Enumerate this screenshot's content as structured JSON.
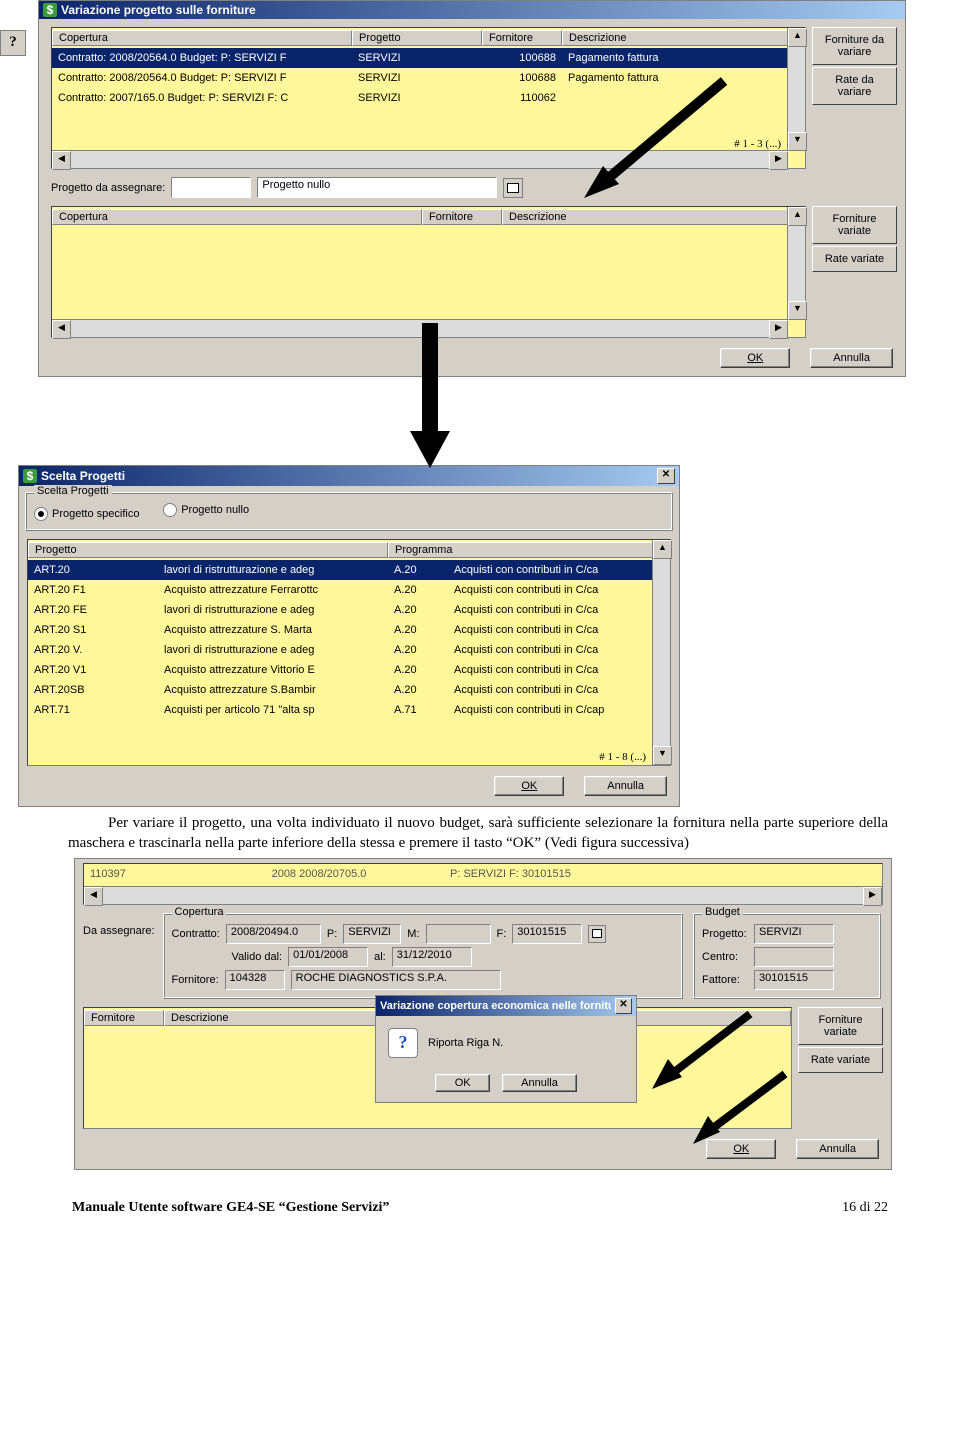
{
  "dialog1": {
    "title": "Variazione progetto sulle forniture",
    "table1": {
      "headers": [
        "Copertura",
        "Progetto",
        "Fornitore",
        "Descrizione"
      ],
      "rows": [
        {
          "cop": "Contratto: 2008/20564.0  Budget: P: SERVIZI F",
          "prog": "SERVIZI",
          "forn": "100688",
          "desc": "Pagamento fattura"
        },
        {
          "cop": "Contratto: 2008/20564.0  Budget: P: SERVIZI F",
          "prog": "SERVIZI",
          "forn": "100688",
          "desc": "Pagamento fattura"
        },
        {
          "cop": "Contratto: 2007/165.0  Budget: P: SERVIZI F: C",
          "prog": "SERVIZI",
          "forn": "110062",
          "desc": ""
        }
      ],
      "pager": "# 1 - 3  (...)"
    },
    "side1": {
      "forniture": "Forniture da variare",
      "rate": "Rate da variare"
    },
    "progetto_label": "Progetto da assegnare:",
    "progetto_code": "",
    "progetto_nullo": "Progetto nullo",
    "table2": {
      "headers": [
        "Copertura",
        "Fornitore",
        "Descrizione"
      ]
    },
    "side2": {
      "forniture": "Forniture variate",
      "rate": "Rate variate"
    },
    "ok": "OK",
    "annulla": "Annulla"
  },
  "dialog2": {
    "title": "Scelta Progetti",
    "group": "Scelta Progetti",
    "radio1": "Progetto specifico",
    "radio2": "Progetto nullo",
    "table": {
      "headers": [
        "Progetto",
        "",
        "Programma",
        ""
      ],
      "rows": [
        {
          "p": "ART.20",
          "d": "lavori di ristrutturazione e adeg",
          "g": "A.20",
          "gd": "Acquisti con contributi in C/ca"
        },
        {
          "p": "ART.20 F1",
          "d": "Acquisto attrezzature Ferrarottc",
          "g": "A.20",
          "gd": "Acquisti con contributi in C/ca"
        },
        {
          "p": "ART.20 FE",
          "d": "lavori di ristrutturazione e adeg",
          "g": "A.20",
          "gd": "Acquisti con contributi in C/ca"
        },
        {
          "p": "ART.20 S1",
          "d": "Acquisto attrezzature S. Marta",
          "g": "A.20",
          "gd": "Acquisti con contributi in C/ca"
        },
        {
          "p": "ART.20 V.",
          "d": "lavori di ristrutturazione e adeg",
          "g": "A.20",
          "gd": "Acquisti con contributi in C/ca"
        },
        {
          "p": "ART.20 V1",
          "d": "Acquisto attrezzature Vittorio E",
          "g": "A.20",
          "gd": "Acquisti con contributi in C/ca"
        },
        {
          "p": "ART.20SB",
          "d": "Acquisto attrezzature S.Bambir",
          "g": "A.20",
          "gd": "Acquisti con contributi in C/ca"
        },
        {
          "p": "ART.71",
          "d": "Acquisti per articolo 71 \"alta sp",
          "g": "A.71",
          "gd": "Acquisti con contributi in C/cap"
        }
      ],
      "pager": "# 1 - 8  (...)"
    },
    "ok": "OK",
    "annulla": "Annulla"
  },
  "paragraph": {
    "line1_pre": "Per variare il progetto, una volta individuato il nuovo budget, sarà sufficiente selezionare la",
    "line2": "fornitura nella parte superiore della maschera e trascinarla nella parte inferiore della stessa e premere il tasto “OK” (Vedi figura successiva)"
  },
  "dialog3": {
    "top_row": {
      "a": "110397",
      "b": "2008  2008/20705.0",
      "c": "P: SERVIZI F: 30101515"
    },
    "da_assegnare": "Da assegnare:",
    "copertura_label": "Copertura",
    "contratto_label": "Contratto:",
    "contratto": "2008/20494.0",
    "p_label": "P:",
    "p": "SERVIZI",
    "m_label": "M:",
    "m": "",
    "f_label": "F:",
    "f": "30101515",
    "valido_dal_label": "Valido dal:",
    "valido_dal": "01/01/2008",
    "al_label": "al:",
    "al": "31/12/2010",
    "fornitore_label": "Fornitore:",
    "fornitore": "104328",
    "fornitore_name": "ROCHE DIAGNOSTICS S.P.A.",
    "budget_label": "Budget",
    "progetto_label": "Progetto:",
    "progetto": "SERVIZI",
    "centro_label": "Centro:",
    "centro": "",
    "fattore_label": "Fattore:",
    "fattore": "30101515",
    "lower_headers": [
      "Fornitore",
      "Descrizione"
    ],
    "side": {
      "forniture": "Forniture variate",
      "rate": "Rate variate"
    },
    "inner_dialog": {
      "title": "Variazione copertura economica nelle forniture",
      "msg": "Riporta Riga N.",
      "ok": "OK",
      "annulla": "Annulla"
    },
    "ok": "OK",
    "annulla": "Annulla"
  },
  "footer": {
    "title": "Manuale Utente software GE4-SE “Gestione Servizi”",
    "page": "16 di 22"
  }
}
